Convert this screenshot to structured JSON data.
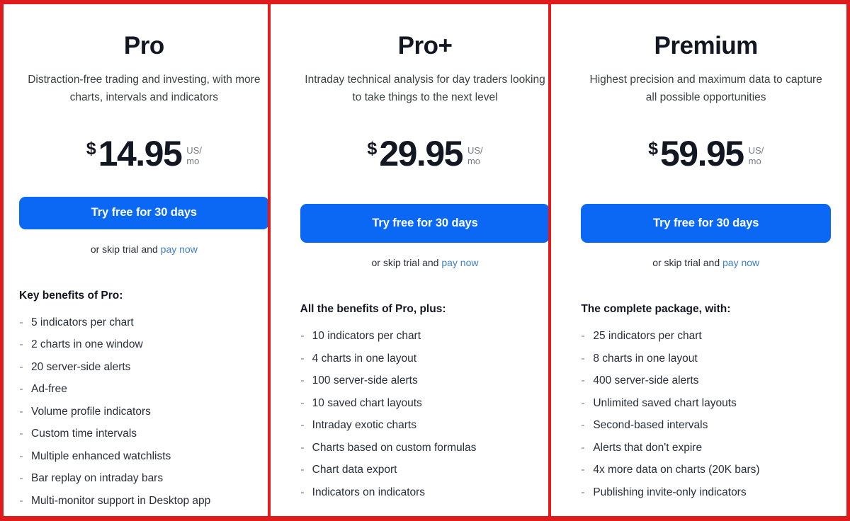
{
  "theme": {
    "frame_border_color": "#e01b1b",
    "cta_color": "#0a68f5",
    "link_color": "#3e7ec9",
    "text_color": "#131722",
    "muted_text_color": "#787b86"
  },
  "plans": [
    {
      "name": "Pro",
      "tagline": "Distraction-free trading and investing, with more charts, intervals and indicators",
      "currency": "$",
      "amount": "14.95",
      "period_line1": "US/",
      "period_line2": "mo",
      "cta_label": "Try free for 30 days",
      "skip_text": "or skip trial and",
      "pay_now_label": "pay now",
      "benefits_heading": "Key benefits of Pro:",
      "benefits": [
        "5 indicators per chart",
        "2 charts in one window",
        "20 server-side alerts",
        "Ad-free",
        "Volume profile indicators",
        "Custom time intervals",
        "Multiple enhanced watchlists",
        "Bar replay on intraday bars",
        "Multi-monitor support in Desktop app"
      ]
    },
    {
      "name": "Pro+",
      "tagline": "Intraday technical analysis for day traders looking to take things to the next level",
      "currency": "$",
      "amount": "29.95",
      "period_line1": "US/",
      "period_line2": "mo",
      "cta_label": "Try free for 30 days",
      "skip_text": "or skip trial and",
      "pay_now_label": "pay now",
      "benefits_heading": "All the benefits of Pro, plus:",
      "benefits": [
        "10 indicators per chart",
        "4 charts in one layout",
        "100 server-side alerts",
        "10 saved chart layouts",
        "Intraday exotic charts",
        "Charts based on custom formulas",
        "Chart data export",
        "Indicators on indicators"
      ]
    },
    {
      "name": "Premium",
      "tagline": "Highest precision and maximum data to capture all possible opportunities",
      "currency": "$",
      "amount": "59.95",
      "period_line1": "US/",
      "period_line2": "mo",
      "cta_label": "Try free for 30 days",
      "skip_text": "or skip trial and",
      "pay_now_label": "pay now",
      "benefits_heading": "The complete package, with:",
      "benefits": [
        "25 indicators per chart",
        "8 charts in one layout",
        "400 server-side alerts",
        "Unlimited saved chart layouts",
        "Second-based intervals",
        "Alerts that don't expire",
        "4x more data on charts (20K bars)",
        "Publishing invite-only indicators"
      ]
    }
  ]
}
